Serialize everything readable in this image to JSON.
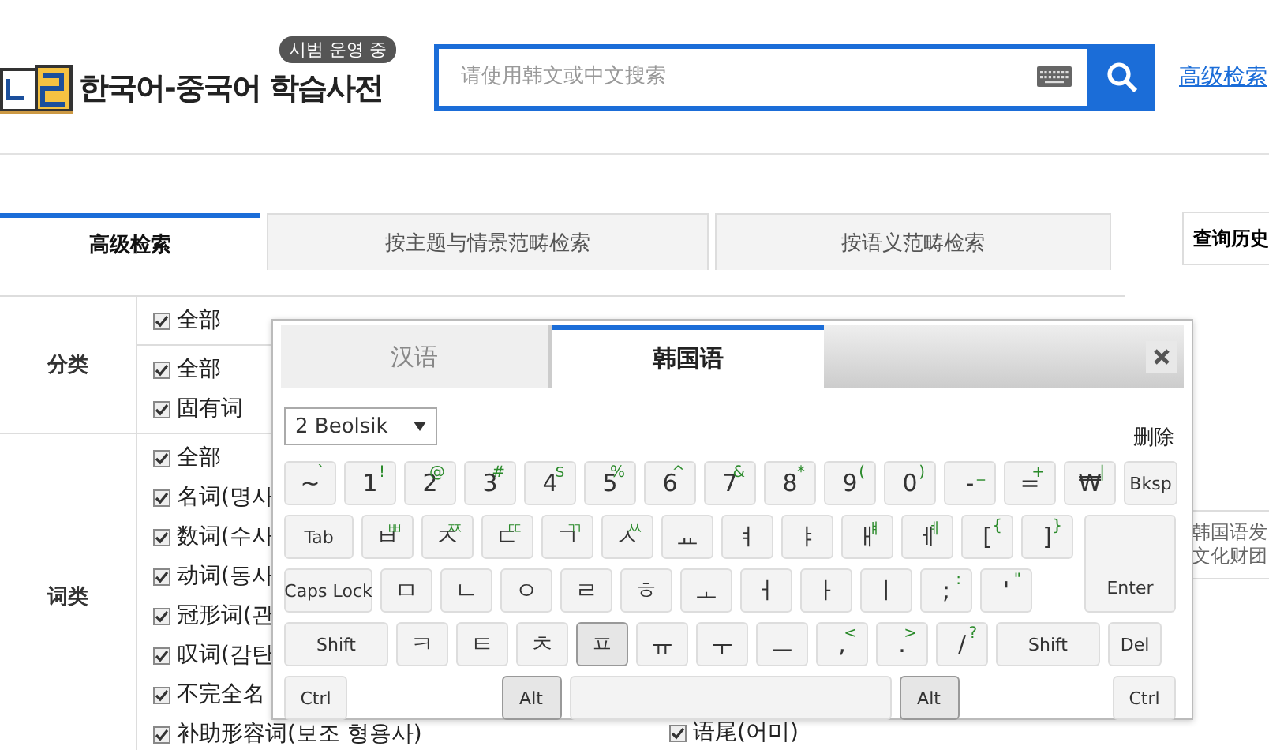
{
  "header": {
    "logo": "한국어-중국어 학습사전",
    "badge": "시범 운영 중",
    "search": {
      "placeholder": "请使用韩文或中文搜索"
    },
    "advanced_link": "高级检索"
  },
  "tabs": [
    {
      "label": "高级检索",
      "selected": true
    },
    {
      "label": "按主题与情景范畴检索",
      "selected": false
    },
    {
      "label": "按语义范畴检索",
      "selected": false
    }
  ],
  "filters": [
    {
      "label": "分类",
      "groups": [
        [
          {
            "label": "全部",
            "checked": true
          }
        ],
        [
          {
            "label": "全部",
            "checked": true
          },
          {
            "label": "固有词",
            "checked": true
          }
        ]
      ]
    },
    {
      "label": "词类",
      "groups": [
        [
          {
            "label": "全部",
            "checked": true
          },
          {
            "label": "名词(명사",
            "checked": true
          },
          {
            "label": "数词(수사",
            "checked": true
          },
          {
            "label": "动词(동사",
            "checked": true
          },
          {
            "label": "冠形词(관",
            "checked": true
          },
          {
            "label": "叹词(감탄",
            "checked": true
          },
          {
            "label": "不完全名",
            "checked": true
          },
          {
            "label": "补助形容词(보조 형용사)",
            "checked": true
          }
        ]
      ]
    }
  ],
  "extra_option": {
    "label": "语尾(어미)",
    "checked": true
  },
  "sidebar": {
    "title": "查询历史",
    "lines": [
      "韩国语发",
      "文化财团"
    ]
  },
  "keyboard": {
    "tabs": [
      {
        "label": "汉语",
        "selected": false
      },
      {
        "label": "韩国语",
        "selected": true
      }
    ],
    "layout": "2 Beolsik",
    "clear": "删除",
    "rows": [
      {
        "keys": [
          {
            "kind": "char",
            "main": "~",
            "shift": "`",
            "pressed": false
          },
          {
            "kind": "char",
            "main": "1",
            "shift": "!",
            "pressed": false
          },
          {
            "kind": "char",
            "main": "2",
            "shift": "@",
            "pressed": false
          },
          {
            "kind": "char",
            "main": "3",
            "shift": "#",
            "pressed": false
          },
          {
            "kind": "char",
            "main": "4",
            "shift": "$",
            "pressed": false
          },
          {
            "kind": "char",
            "main": "5",
            "shift": "%",
            "pressed": false
          },
          {
            "kind": "char",
            "main": "6",
            "shift": "^",
            "pressed": false
          },
          {
            "kind": "char",
            "main": "7",
            "shift": "&",
            "pressed": false
          },
          {
            "kind": "char",
            "main": "8",
            "shift": "*",
            "pressed": false
          },
          {
            "kind": "char",
            "main": "9",
            "shift": "(",
            "pressed": false
          },
          {
            "kind": "char",
            "main": "0",
            "shift": ")",
            "pressed": false
          },
          {
            "kind": "char",
            "main": "-",
            "shift": "_",
            "pressed": false
          },
          {
            "kind": "char",
            "main": "=",
            "shift": "+",
            "pressed": false
          },
          {
            "kind": "char",
            "main": "₩",
            "shift": "|",
            "pressed": false
          },
          {
            "kind": "bksp",
            "main": "Bksp",
            "pressed": false
          }
        ]
      },
      {
        "keys": [
          {
            "kind": "tab",
            "main": "Tab",
            "pressed": false
          },
          {
            "kind": "char",
            "main": "ㅂ",
            "shift": "ㅃ",
            "pressed": false
          },
          {
            "kind": "char",
            "main": "ㅈ",
            "shift": "ㅉ",
            "pressed": false
          },
          {
            "kind": "char",
            "main": "ㄷ",
            "shift": "ㄸ",
            "pressed": false
          },
          {
            "kind": "char",
            "main": "ㄱ",
            "shift": "ㄲ",
            "pressed": false
          },
          {
            "kind": "char",
            "main": "ㅅ",
            "shift": "ㅆ",
            "pressed": false
          },
          {
            "kind": "char",
            "main": "ㅛ",
            "pressed": false
          },
          {
            "kind": "char",
            "main": "ㅕ",
            "pressed": false
          },
          {
            "kind": "char",
            "main": "ㅑ",
            "pressed": false
          },
          {
            "kind": "char",
            "main": "ㅐ",
            "shift": "ㅒ",
            "pressed": false
          },
          {
            "kind": "char",
            "main": "ㅔ",
            "shift": "ㅖ",
            "pressed": false
          },
          {
            "kind": "char",
            "main": "[",
            "shift": "{",
            "pressed": false
          },
          {
            "kind": "char",
            "main": "]",
            "shift": "}",
            "pressed": false
          }
        ]
      },
      {
        "keys": [
          {
            "kind": "caps",
            "main": "Caps Lock",
            "pressed": false
          },
          {
            "kind": "char",
            "main": "ㅁ",
            "pressed": false
          },
          {
            "kind": "char",
            "main": "ㄴ",
            "pressed": false
          },
          {
            "kind": "char",
            "main": "ㅇ",
            "pressed": false
          },
          {
            "kind": "char",
            "main": "ㄹ",
            "pressed": false
          },
          {
            "kind": "char",
            "main": "ㅎ",
            "pressed": false
          },
          {
            "kind": "char",
            "main": "ㅗ",
            "pressed": false
          },
          {
            "kind": "char",
            "main": "ㅓ",
            "pressed": false
          },
          {
            "kind": "char",
            "main": "ㅏ",
            "pressed": false
          },
          {
            "kind": "char",
            "main": "ㅣ",
            "pressed": false
          },
          {
            "kind": "char",
            "main": ";",
            "shift": ":",
            "pressed": false
          },
          {
            "kind": "char",
            "main": "'",
            "shift": "\"",
            "pressed": false
          }
        ]
      },
      {
        "keys": [
          {
            "kind": "shift",
            "main": "Shift",
            "pressed": false
          },
          {
            "kind": "char",
            "main": "ㅋ",
            "pressed": false
          },
          {
            "kind": "char",
            "main": "ㅌ",
            "pressed": false
          },
          {
            "kind": "char",
            "main": "ㅊ",
            "pressed": false
          },
          {
            "kind": "char",
            "main": "ㅍ",
            "pressed": true
          },
          {
            "kind": "char",
            "main": "ㅠ",
            "pressed": false
          },
          {
            "kind": "char",
            "main": "ㅜ",
            "pressed": false
          },
          {
            "kind": "char",
            "main": "ㅡ",
            "pressed": false
          },
          {
            "kind": "char",
            "main": ",",
            "shift": "<",
            "pressed": false
          },
          {
            "kind": "char",
            "main": ".",
            "shift": ">",
            "pressed": false
          },
          {
            "kind": "char",
            "main": "/",
            "shift": "?",
            "pressed": false
          },
          {
            "kind": "shift",
            "main": "Shift",
            "pressed": false
          },
          {
            "kind": "del",
            "main": "Del",
            "pressed": false
          }
        ]
      },
      {
        "keys": [
          {
            "kind": "ctrl",
            "main": "Ctrl",
            "pressed": false
          },
          {
            "kind": "alt",
            "main": "Alt",
            "pressed": true
          },
          {
            "kind": "space",
            "pressed": false
          },
          {
            "kind": "alt",
            "main": "Alt",
            "pressed": true
          },
          {
            "kind": "ctrl",
            "main": "Ctrl",
            "pressed": false
          }
        ]
      }
    ],
    "enter": {
      "main": "Enter",
      "pressed": false
    }
  }
}
